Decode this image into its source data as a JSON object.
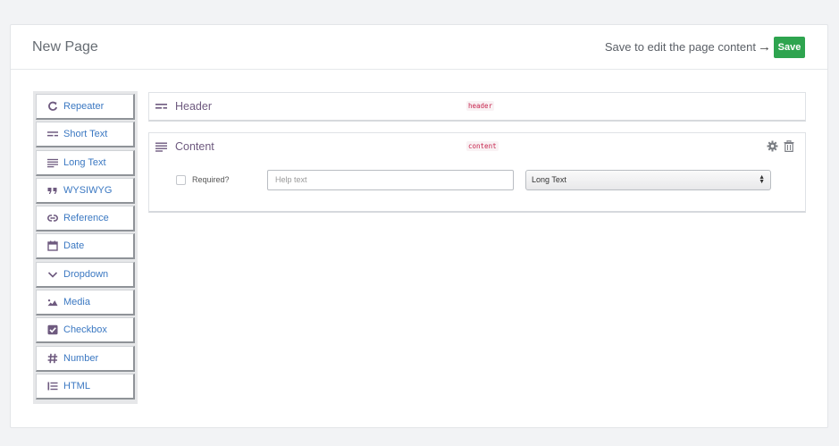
{
  "header": {
    "title": "New Page",
    "save_hint": "Save to edit the page content",
    "arrow": "→",
    "save_label": "Save"
  },
  "toolbox": {
    "items": [
      {
        "label": "Repeater",
        "icon": "repeat-icon"
      },
      {
        "label": "Short Text",
        "icon": "short-text-icon"
      },
      {
        "label": "Long Text",
        "icon": "long-text-icon"
      },
      {
        "label": "WYSIWYG",
        "icon": "quote-icon"
      },
      {
        "label": "Reference",
        "icon": "link-icon"
      },
      {
        "label": "Date",
        "icon": "calendar-icon"
      },
      {
        "label": "Dropdown",
        "icon": "chevron-down-icon"
      },
      {
        "label": "Media",
        "icon": "image-icon"
      },
      {
        "label": "Checkbox",
        "icon": "check-square-icon"
      },
      {
        "label": "Number",
        "icon": "hash-icon"
      },
      {
        "label": "HTML",
        "icon": "list-icon"
      }
    ],
    "accent": "#3b78c2",
    "icon_color": "#6e5a7f"
  },
  "fields": {
    "header": {
      "name": "Header",
      "key": "header",
      "icon": "short-text-icon"
    },
    "content": {
      "name": "Content",
      "key": "content",
      "icon": "long-text-icon",
      "required_label": "Required?",
      "help_placeholder": "Help text",
      "type_value": "Long Text"
    }
  },
  "colors": {
    "save_button": "#2ea44f",
    "key_text": "#c7254e"
  }
}
